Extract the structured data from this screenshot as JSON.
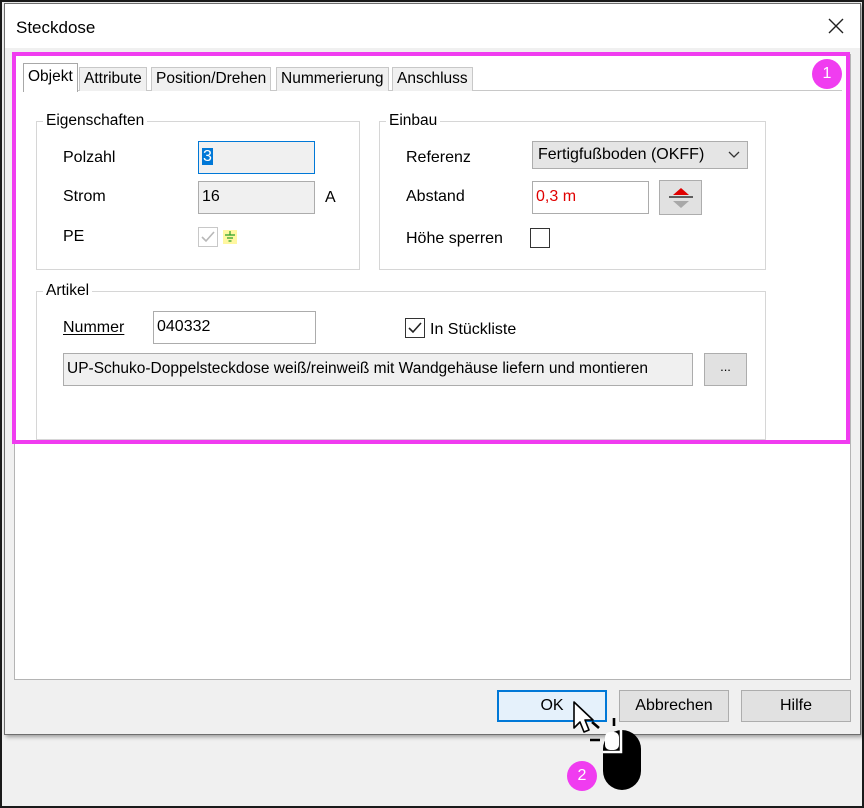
{
  "window": {
    "title": "Steckdose"
  },
  "tabs": [
    {
      "label": "Objekt",
      "active": true
    },
    {
      "label": "Attribute",
      "active": false
    },
    {
      "label": "Position/Drehen",
      "active": false
    },
    {
      "label": "Nummerierung",
      "active": false
    },
    {
      "label": "Anschluss",
      "active": false
    }
  ],
  "eigenschaften": {
    "title": "Eigenschaften",
    "polzahl_label": "Polzahl",
    "polzahl_value": "3",
    "strom_label": "Strom",
    "strom_value": "16",
    "strom_unit": "A",
    "pe_label": "PE",
    "pe_checked": true,
    "pe_icon": "ground-symbol-icon"
  },
  "einbau": {
    "title": "Einbau",
    "referenz_label": "Referenz",
    "referenz_value": "Fertigfußboden (OKFF)",
    "abstand_label": "Abstand",
    "abstand_value": "0,3 m",
    "abstand_color": "#e00000",
    "hoehe_label": "Höhe sperren",
    "hoehe_checked": false
  },
  "artikel": {
    "title": "Artikel",
    "nummer_label": "Nummer",
    "nummer_value": "040332",
    "stueckliste_label": "In Stückliste",
    "stueckliste_checked": true,
    "description": "UP-Schuko-Doppelsteckdose weiß/reinweiß mit Wandgehäuse liefern und montieren",
    "browse_label": "..."
  },
  "buttons": {
    "ok": "OK",
    "cancel": "Abbrechen",
    "help": "Hilfe"
  },
  "annotations": {
    "badge1": "1",
    "badge2": "2",
    "highlight_color": "#f03cf0"
  }
}
